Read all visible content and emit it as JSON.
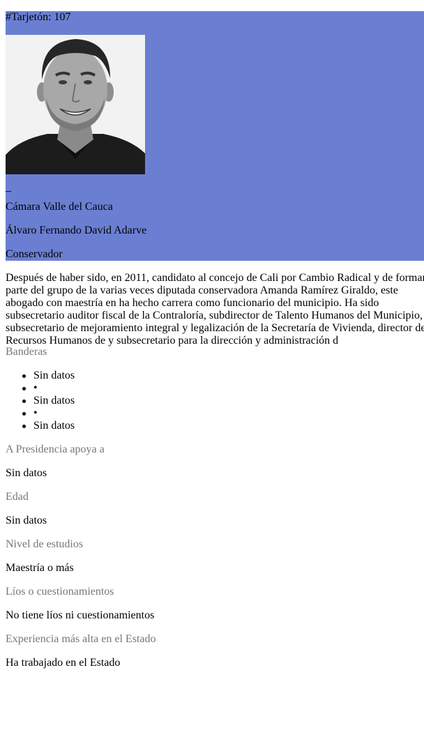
{
  "card": {
    "ballot_number": "#Tarjetón: 107",
    "dash": "_",
    "chamber": "Cámara Valle del Cauca",
    "name": "Álvaro Fernando David Adarve",
    "party": "Conservador",
    "background_color": "#6a7fd2"
  },
  "bio": "Después de haber sido, en 2011, candidato al concejo de Cali por Cambio Radical y de formar parte del grupo de la varias veces diputada conservadora Amanda Ramírez Giraldo, este abogado con maestría en ha hecho carrera como funcionario del municipio. Ha sido subsecretario auditor fiscal de la Contraloría, subdirector de Talento Humanos del Municipio, subsecretario de mejoramiento integral y legalización de la Secretaría de Vivienda, director de Recursos Humanos de y subsecretario para la dirección y administración d",
  "sections": {
    "flags": {
      "label": "Banderas",
      "items": [
        "Sin datos",
        "•",
        "Sin datos",
        "•",
        "Sin datos"
      ]
    },
    "president": {
      "label": "A Presidencia apoya a",
      "value": "Sin datos"
    },
    "age": {
      "label": "Edad",
      "value": "Sin datos"
    },
    "education": {
      "label": "Nivel de estudios",
      "value": "Maestría o más"
    },
    "issues": {
      "label": "Líos o cuestionamientos",
      "value": "No tiene líos ni cuestionamientos"
    },
    "experience": {
      "label": "Experiencia más alta en el Estado",
      "value": "Ha trabajado en el Estado"
    }
  }
}
